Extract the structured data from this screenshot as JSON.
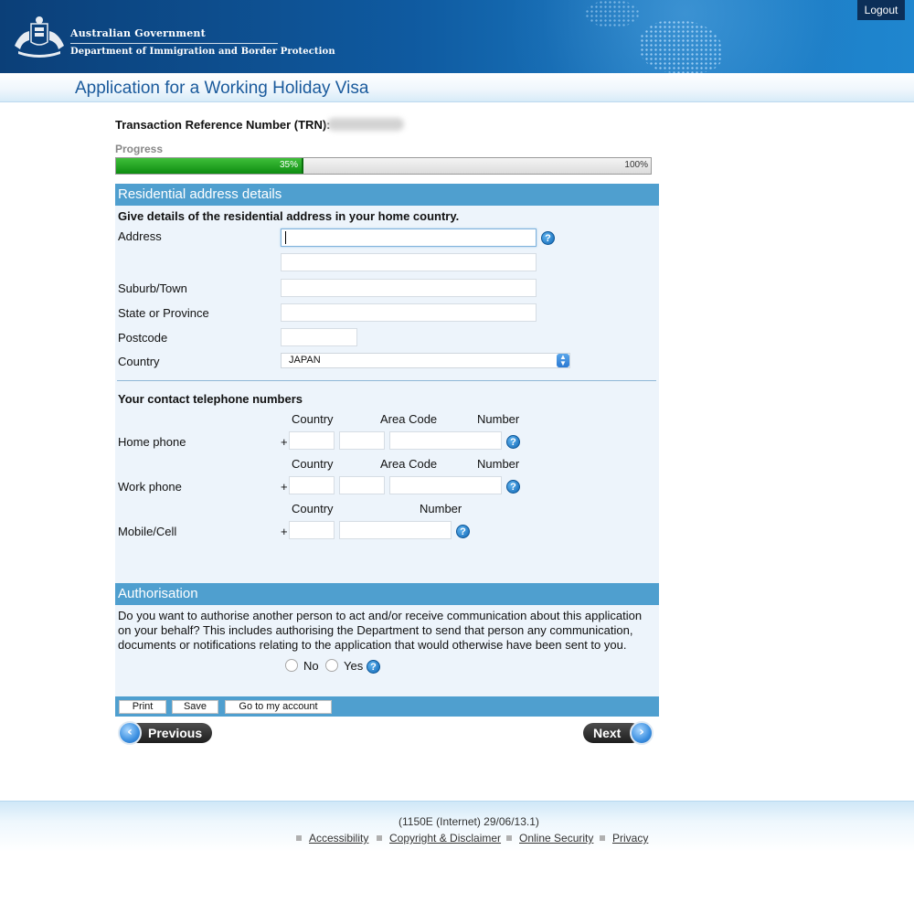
{
  "header": {
    "gov_name": "Australian Government",
    "dept_name": "Department of Immigration and Border Protection",
    "logout_label": "Logout"
  },
  "page_title": "Application for a Working Holiday Visa",
  "trn": {
    "label": "Transaction Reference Number (TRN):"
  },
  "progress": {
    "label": "Progress",
    "value_label": "35%",
    "value": 35,
    "max_label": "100%"
  },
  "address": {
    "heading": "Residential address details",
    "instruction": "Give details of the residential address in your home country.",
    "address_label": "Address",
    "address_line1": "",
    "address_line2": "",
    "suburb_label": "Suburb/Town",
    "state_label": "State or Province",
    "postcode_label": "Postcode",
    "country_label": "Country",
    "country_value": "JAPAN"
  },
  "phones": {
    "heading": "Your contact telephone numbers",
    "col_country": "Country",
    "col_area": "Area Code",
    "col_number": "Number",
    "home_label": "Home phone",
    "work_label": "Work phone",
    "mobile_label": "Mobile/Cell",
    "plus": "+"
  },
  "authorisation": {
    "heading": "Authorisation",
    "question": "Do you want to authorise another person to act and/or receive communication about this application on your behalf? This includes authorising the Department to send that person any communication, documents or notifications relating to the application that would otherwise have been sent to you.",
    "no_label": "No",
    "yes_label": "Yes"
  },
  "buttons": {
    "print": "Print",
    "save": "Save",
    "account": "Go to my account",
    "previous": "Previous",
    "next": "Next"
  },
  "help_icon": "?",
  "footer": {
    "code": "(1150E (Internet) 29/06/13.1)",
    "links": [
      "Accessibility",
      "Copyright & Disclaimer",
      "Online Security",
      "Privacy"
    ]
  },
  "colors": {
    "header_blue": "#0f5aa0",
    "section_blue": "#4f9fcf",
    "panel_bg": "#edf4fb",
    "progress_green": "#0e8d11"
  },
  "icons": {
    "crest": "coat-of-arms-icon",
    "help": "help-icon",
    "previous": "arrow-left-icon",
    "next": "arrow-right-icon"
  }
}
